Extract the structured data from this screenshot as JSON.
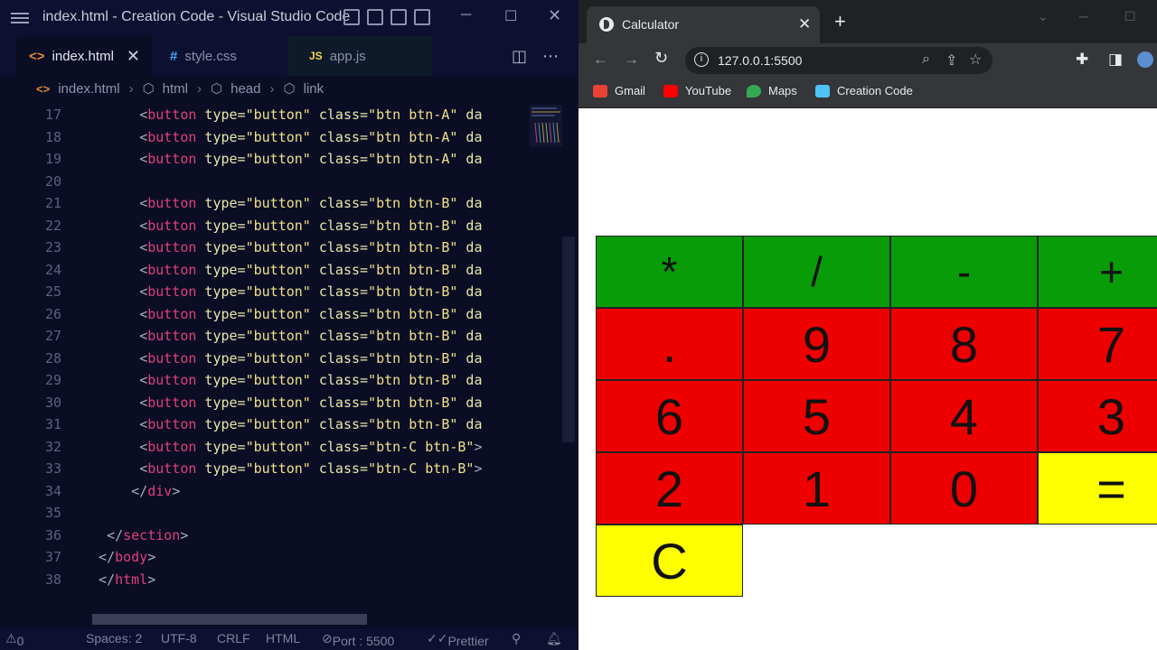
{
  "vscode": {
    "window_title": "index.html - Creation Code - Visual Studio Code",
    "tabs": [
      {
        "icon": "<>",
        "label": "index.html",
        "active": true
      },
      {
        "icon": "#",
        "label": "style.css",
        "active": false
      },
      {
        "icon": "JS",
        "label": "app.js",
        "active": false
      }
    ],
    "breadcrumb": [
      "index.html",
      "html",
      "head",
      "link"
    ],
    "code_lines": [
      {
        "n": "17",
        "indent": "      ",
        "tag": "button",
        "attrs": " type=\"button\" class=\"btn btn-A\" da",
        "close": ""
      },
      {
        "n": "18",
        "indent": "      ",
        "tag": "button",
        "attrs": " type=\"button\" class=\"btn btn-A\" da",
        "close": ""
      },
      {
        "n": "19",
        "indent": "      ",
        "tag": "button",
        "attrs": " type=\"button\" class=\"btn btn-A\" da",
        "close": ""
      },
      {
        "n": "20",
        "indent": "",
        "tag": "",
        "attrs": "",
        "close": ""
      },
      {
        "n": "21",
        "indent": "      ",
        "tag": "button",
        "attrs": " type=\"button\" class=\"btn btn-B\" da",
        "close": ""
      },
      {
        "n": "22",
        "indent": "      ",
        "tag": "button",
        "attrs": " type=\"button\" class=\"btn btn-B\" da",
        "close": ""
      },
      {
        "n": "23",
        "indent": "      ",
        "tag": "button",
        "attrs": " type=\"button\" class=\"btn btn-B\" da",
        "close": ""
      },
      {
        "n": "24",
        "indent": "      ",
        "tag": "button",
        "attrs": " type=\"button\" class=\"btn btn-B\" da",
        "close": ""
      },
      {
        "n": "25",
        "indent": "      ",
        "tag": "button",
        "attrs": " type=\"button\" class=\"btn btn-B\" da",
        "close": ""
      },
      {
        "n": "26",
        "indent": "      ",
        "tag": "button",
        "attrs": " type=\"button\" class=\"btn btn-B\" da",
        "close": ""
      },
      {
        "n": "27",
        "indent": "      ",
        "tag": "button",
        "attrs": " type=\"button\" class=\"btn btn-B\" da",
        "close": ""
      },
      {
        "n": "28",
        "indent": "      ",
        "tag": "button",
        "attrs": " type=\"button\" class=\"btn btn-B\" da",
        "close": ""
      },
      {
        "n": "29",
        "indent": "      ",
        "tag": "button",
        "attrs": " type=\"button\" class=\"btn btn-B\" da",
        "close": ""
      },
      {
        "n": "30",
        "indent": "      ",
        "tag": "button",
        "attrs": " type=\"button\" class=\"btn btn-B\" da",
        "close": ""
      },
      {
        "n": "31",
        "indent": "      ",
        "tag": "button",
        "attrs": " type=\"button\" class=\"btn btn-B\" da",
        "close": ""
      },
      {
        "n": "32",
        "indent": "      ",
        "tag": "button",
        "attrs": " type=\"button\" class=\"btn-C btn-B\">",
        "close": ""
      },
      {
        "n": "33",
        "indent": "      ",
        "tag": "button",
        "attrs": " type=\"button\" class=\"btn-C btn-B\">",
        "close": ""
      },
      {
        "n": "34",
        "indent": "     ",
        "tag": "/div",
        "attrs": "",
        "close": ">"
      },
      {
        "n": "35",
        "indent": "",
        "tag": "",
        "attrs": "",
        "close": ""
      },
      {
        "n": "36",
        "indent": "  ",
        "tag": "/section",
        "attrs": "",
        "close": ">"
      },
      {
        "n": "37",
        "indent": " ",
        "tag": "/body",
        "attrs": "",
        "close": ">"
      },
      {
        "n": "38",
        "indent": " ",
        "tag": "/html",
        "attrs": "",
        "close": ">"
      }
    ],
    "status": {
      "problems": "0",
      "spaces": "Spaces: 2",
      "encoding": "UTF-8",
      "eol": "CRLF",
      "language": "HTML",
      "port": "Port : 5500",
      "prettier": "Prettier"
    }
  },
  "browser": {
    "tab_title": "Calculator",
    "url": "127.0.0.1:5500",
    "bookmarks": [
      {
        "label": "Gmail",
        "color": "#ea4335"
      },
      {
        "label": "YouTube",
        "color": "#ff0000"
      },
      {
        "label": "Maps",
        "color": "#34a853"
      },
      {
        "label": "Creation Code",
        "color": "#4fc3f7"
      }
    ],
    "calculator_keys": [
      {
        "label": "*",
        "kind": "op"
      },
      {
        "label": "/",
        "kind": "op"
      },
      {
        "label": "-",
        "kind": "op"
      },
      {
        "label": "+",
        "kind": "op"
      },
      {
        "label": ".",
        "kind": "num"
      },
      {
        "label": "9",
        "kind": "num"
      },
      {
        "label": "8",
        "kind": "num"
      },
      {
        "label": "7",
        "kind": "num"
      },
      {
        "label": "6",
        "kind": "num"
      },
      {
        "label": "5",
        "kind": "num"
      },
      {
        "label": "4",
        "kind": "num"
      },
      {
        "label": "3",
        "kind": "num"
      },
      {
        "label": "2",
        "kind": "num"
      },
      {
        "label": "1",
        "kind": "num"
      },
      {
        "label": "0",
        "kind": "num"
      },
      {
        "label": "=",
        "kind": "fn"
      },
      {
        "label": "C",
        "kind": "fn"
      }
    ]
  }
}
